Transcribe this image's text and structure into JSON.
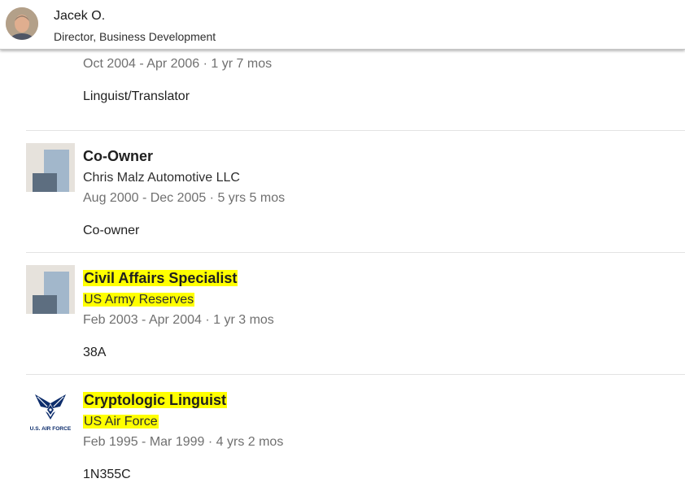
{
  "header": {
    "name": "Jacek O.",
    "title": "Director, Business Development"
  },
  "experience": [
    {
      "title": "",
      "company": "",
      "dates": "Oct 2004 - Apr 2006 · 1 yr 7 mos",
      "description": "Linguist/Translator",
      "logo": "placeholder-logo"
    },
    {
      "title": "Co-Owner",
      "company": "Chris Malz Automotive LLC",
      "dates": "Aug 2000 - Dec 2005 · 5 yrs 5 mos",
      "description": "Co-owner",
      "logo": "placeholder-logo"
    },
    {
      "title": "Civil Affairs Specialist",
      "company": "US Army Reserves",
      "dates": "Feb 2003 - Apr 2004 · 1 yr 3 mos",
      "description": "38A",
      "logo": "placeholder-logo",
      "highlighted": true
    },
    {
      "title": "Cryptologic Linguist",
      "company": "US Air Force",
      "dates": "Feb 1995 - Mar 1999 · 4 yrs 2 mos",
      "description": "1N355C",
      "logo": "us-air-force-logo",
      "logo_text": "U.S. AIR FORCE",
      "highlighted": true
    }
  ],
  "colors": {
    "highlight": "#ffff00",
    "placeholder_bg": "#e6e2dc",
    "placeholder_light": "#a2b7cb",
    "placeholder_dark": "#5d6e80",
    "usaf_blue": "#0d2d6c"
  }
}
